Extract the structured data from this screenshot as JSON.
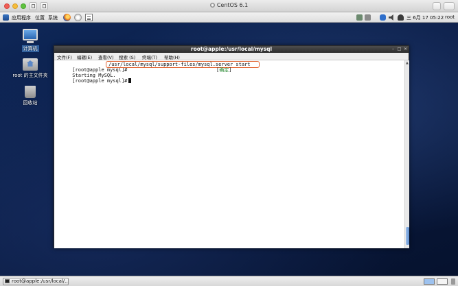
{
  "host": {
    "title": "CentOS 6.1"
  },
  "top_panel": {
    "menu_applications": "应用程序",
    "menu_places": "位置",
    "menu_system": "系统",
    "clock": "三 6月 17 05:22",
    "username": "root"
  },
  "desktop": {
    "icons": [
      {
        "label": "计算机",
        "icon": "computer-icon"
      },
      {
        "label": "root 的主文件夹",
        "icon": "home-folder-icon"
      },
      {
        "label": "回收站",
        "icon": "trash-icon"
      }
    ]
  },
  "terminal": {
    "title": "root@apple:/usr/local/mysql",
    "menu": [
      "文件(F)",
      "编辑(E)",
      "查看(V)",
      "搜索 (S)",
      "终端(T)",
      "帮助(H)"
    ],
    "lines": {
      "line1_prompt": "[root@apple mysql]#",
      "line1_command": "/usr/local/mysql/support-files/mysql.server start",
      "line2_text": "Starting MySQL.",
      "line2_status_open": "[",
      "line2_status": "确定",
      "line2_status_close": "]",
      "line3_prompt": "[root@apple mysql]#"
    }
  },
  "bottom_panel": {
    "task_label": "root@apple:/usr/local/..."
  },
  "colors": {
    "highlight_box": "#e2622f",
    "ok_status": "#20852b",
    "active_workspace": "#9dc2ef"
  }
}
